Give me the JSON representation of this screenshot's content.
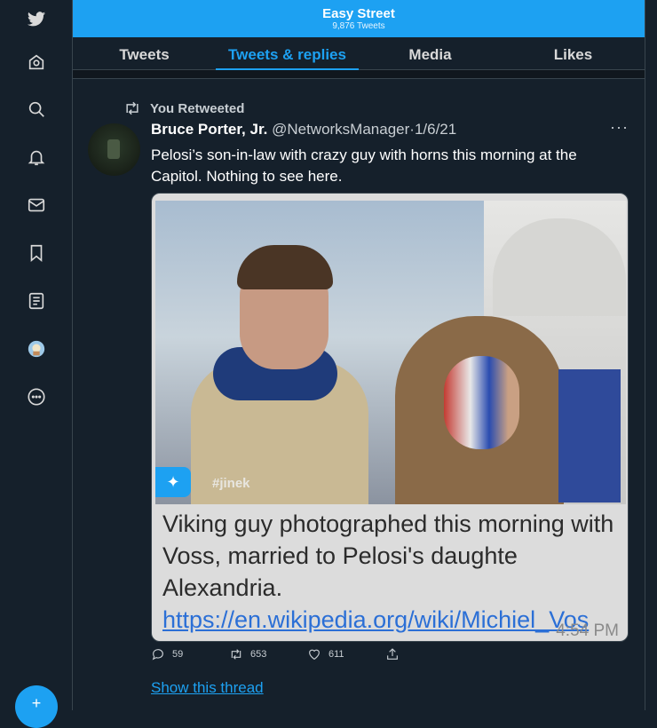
{
  "header": {
    "title": "Easy Street",
    "tweet_count": "9,876 Tweets"
  },
  "tabs": [
    {
      "label": "Tweets",
      "active": false
    },
    {
      "label": "Tweets & replies",
      "active": true
    },
    {
      "label": "Media",
      "active": false
    },
    {
      "label": "Likes",
      "active": false
    }
  ],
  "sidebar": {
    "icons": [
      "twitter-logo-icon",
      "home-icon",
      "explore-search-icon",
      "notifications-bell-icon",
      "messages-envelope-icon",
      "bookmarks-icon",
      "lists-icon",
      "profile-avatar-icon",
      "more-options-icon"
    ],
    "compose_label": "+"
  },
  "tweet": {
    "retweet_label": "You Retweeted",
    "author_name": "Bruce Porter, Jr.",
    "handle": "@NetworksManager",
    "separator": "·",
    "date": "1/6/21",
    "more": "···",
    "text": "Pelosi’s son-in-law with crazy guy with horns this morning at the Capitol. Nothing to see here.",
    "media": {
      "watermark_handle": "#jinek",
      "caption_text": "Viking guy photographed this morning with Voss, married to Pelosi's daughte Alexandria.",
      "caption_link": "https://en.wikipedia.org/wiki/Michiel_Vos",
      "caption_time": "4:54 PM"
    },
    "actions": {
      "replies": "59",
      "retweets": "653",
      "likes": "611"
    },
    "show_thread": "Show this thread"
  },
  "colors": {
    "accent": "#1da1f2",
    "background": "#15202b",
    "border": "#38444d"
  }
}
